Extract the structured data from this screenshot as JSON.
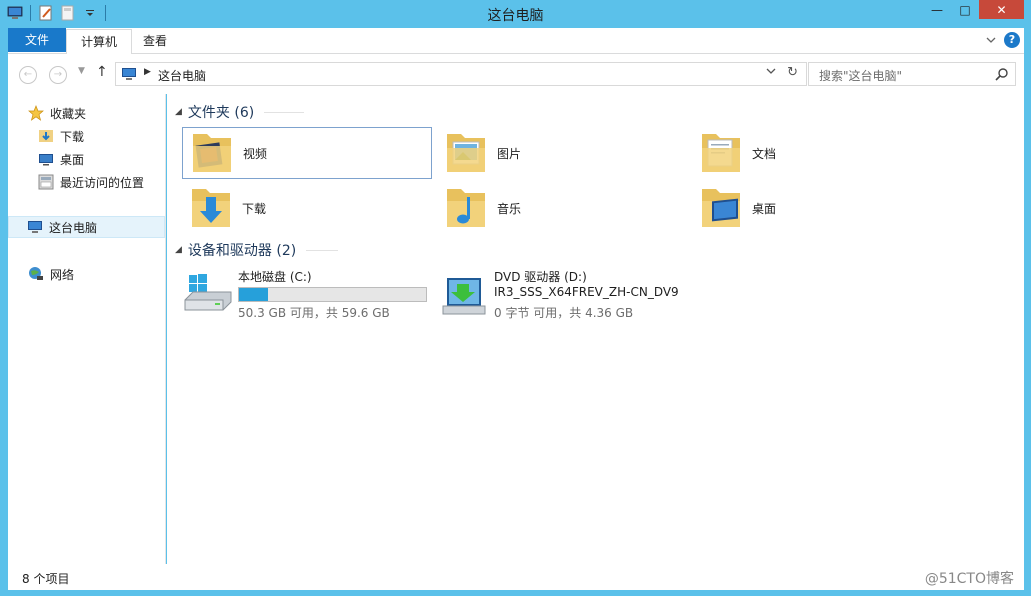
{
  "window": {
    "title": "这台电脑",
    "minimize": "—",
    "maximize": "□",
    "close": "✕"
  },
  "ribbon": {
    "tabs": [
      "文件",
      "计算机",
      "查看"
    ],
    "help": "?"
  },
  "address": {
    "path": "这台电脑"
  },
  "search": {
    "placeholder": "搜索\"这台电脑\""
  },
  "nav": {
    "favorites_label": "收藏夹",
    "favorites": [
      "下载",
      "桌面",
      "最近访问的位置"
    ],
    "this_pc": "这台电脑",
    "network": "网络"
  },
  "groups": {
    "folders": "文件夹 (6)",
    "devices": "设备和驱动器 (2)"
  },
  "folders": [
    "视频",
    "图片",
    "文档",
    "下载",
    "音乐",
    "桌面"
  ],
  "drives": [
    {
      "name": "本地磁盘 (C:)",
      "free": "50.3 GB 可用，共 59.6 GB",
      "used_fraction": 0.156
    },
    {
      "name": "DVD 驱动器 (D:)",
      "label": "IR3_SSS_X64FREV_ZH-CN_DV9",
      "free": "0 字节 可用，共 4.36 GB"
    }
  ],
  "status": {
    "count": "8 个项目"
  },
  "watermark": "@51CTO博客",
  "colors": {
    "accent": "#1979ca",
    "frame": "#5bc1ea",
    "selection": "#e5f3fb",
    "drive_fill": "#26a0da",
    "close": "#c7493a"
  }
}
